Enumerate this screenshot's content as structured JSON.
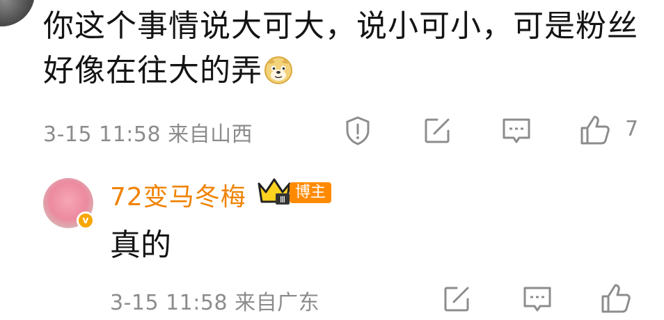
{
  "comment": {
    "text": "你这个事情说大可大，说小可小，可是粉丝好像在往大的弄",
    "emoji": "doge-emoji",
    "time": "3-15 11:58",
    "location": "来自山西",
    "like_count": "7"
  },
  "reply": {
    "username": "72变马冬梅",
    "tag": "博主",
    "text": "真的",
    "time": "3-15 11:58",
    "location": "来自广东"
  },
  "colors": {
    "username": "#f08200",
    "tag_bg": "#ff8a00",
    "meta": "#8c8c8c",
    "icon": "#8c8c8c"
  },
  "icons": [
    "report-icon",
    "share-icon",
    "comment-icon",
    "like-icon",
    "crown-icon",
    "verified-badge-icon"
  ]
}
